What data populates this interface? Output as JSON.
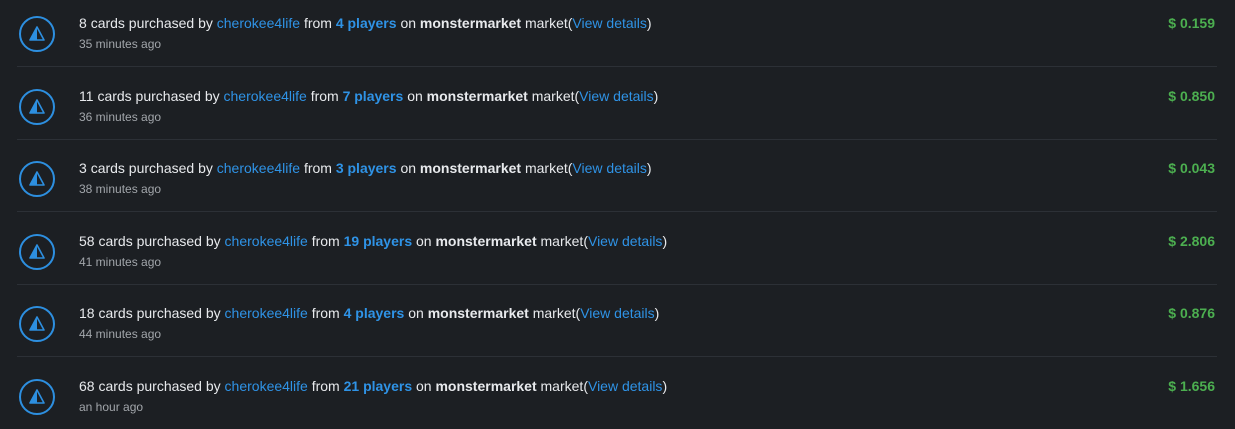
{
  "colors": {
    "background": "#1c1f23",
    "text": "#e8eaed",
    "link": "#2f93e6",
    "muted": "#a2a6ab",
    "amount": "#4caf50",
    "divider": "#2c3036"
  },
  "icon": "pyramid-icon",
  "text": {
    "purchased_by": "cards purchased by",
    "from": "from",
    "on": "on",
    "market_word": "market",
    "paren_open": "(",
    "paren_close": ")"
  },
  "activities": [
    {
      "count": "8",
      "user": "cherokee4life",
      "players": "4 players",
      "market": "monstermarket",
      "details": "View details",
      "time": "35 minutes ago",
      "amount": "$ 0.159"
    },
    {
      "count": "11",
      "user": "cherokee4life",
      "players": "7 players",
      "market": "monstermarket",
      "details": "View details",
      "time": "36 minutes ago",
      "amount": "$ 0.850"
    },
    {
      "count": "3",
      "user": "cherokee4life",
      "players": "3 players",
      "market": "monstermarket",
      "details": "View details",
      "time": "38 minutes ago",
      "amount": "$ 0.043"
    },
    {
      "count": "58",
      "user": "cherokee4life",
      "players": "19 players",
      "market": "monstermarket",
      "details": "View details",
      "time": "41 minutes ago",
      "amount": "$ 2.806"
    },
    {
      "count": "18",
      "user": "cherokee4life",
      "players": "4 players",
      "market": "monstermarket",
      "details": "View details",
      "time": "44 minutes ago",
      "amount": "$ 0.876"
    },
    {
      "count": "68",
      "user": "cherokee4life",
      "players": "21 players",
      "market": "monstermarket",
      "details": "View details",
      "time": "an hour ago",
      "amount": "$ 1.656"
    }
  ]
}
